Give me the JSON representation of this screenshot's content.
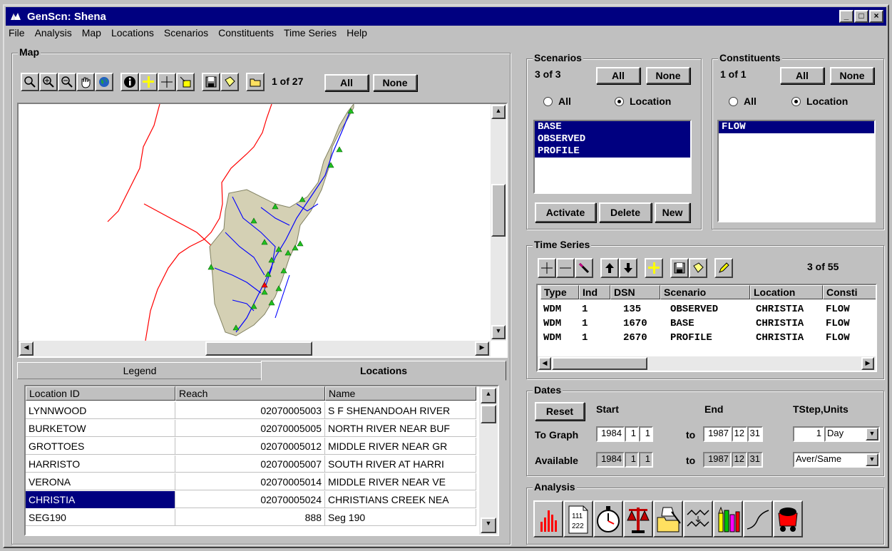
{
  "window": {
    "title": "GenScn: Shena"
  },
  "menu": [
    "File",
    "Analysis",
    "Map",
    "Locations",
    "Scenarios",
    "Constituents",
    "Time Series",
    "Help"
  ],
  "map": {
    "label": "Map",
    "count": "1 of 27",
    "all": "All",
    "none": "None",
    "tabs": {
      "legend": "Legend",
      "locations": "Locations"
    }
  },
  "locations": {
    "headers": [
      "Location ID",
      "Reach",
      "Name"
    ],
    "rows": [
      {
        "id": "LYNNWOOD",
        "reach": "02070005003",
        "name": "S F SHENANDOAH RIVER"
      },
      {
        "id": "BURKETOW",
        "reach": "02070005005",
        "name": "NORTH RIVER NEAR BUF"
      },
      {
        "id": "GROTTOES",
        "reach": "02070005012",
        "name": "MIDDLE RIVER NEAR GR"
      },
      {
        "id": "HARRISTO",
        "reach": "02070005007",
        "name": "SOUTH RIVER AT HARRI"
      },
      {
        "id": "VERONA",
        "reach": "02070005014",
        "name": "MIDDLE RIVER NEAR VE"
      },
      {
        "id": "CHRISTIA",
        "reach": "02070005024",
        "name": "CHRISTIANS CREEK NEA"
      },
      {
        "id": "SEG190",
        "reach": "888",
        "name": "Seg 190"
      }
    ],
    "selected": 5
  },
  "scenarios": {
    "label": "Scenarios",
    "count": "3 of 3",
    "all": "All",
    "none": "None",
    "radio_all": "All",
    "radio_location": "Location",
    "items": [
      "BASE",
      "OBSERVED",
      "PROFILE"
    ],
    "activate": "Activate",
    "delete": "Delete",
    "new": "New"
  },
  "constituents": {
    "label": "Constituents",
    "count": "1 of 1",
    "all": "All",
    "none": "None",
    "radio_all": "All",
    "radio_location": "Location",
    "items": [
      "FLOW"
    ]
  },
  "timeseries": {
    "label": "Time Series",
    "count": "3 of 55",
    "headers": [
      "Type",
      "Ind",
      "DSN",
      "Scenario",
      "Location",
      "Consti"
    ],
    "rows": [
      [
        "WDM",
        "1",
        "135",
        "OBSERVED",
        "CHRISTIA",
        "FLOW"
      ],
      [
        "WDM",
        "1",
        "1670",
        "BASE",
        "CHRISTIA",
        "FLOW"
      ],
      [
        "WDM",
        "1",
        "2670",
        "PROFILE",
        "CHRISTIA",
        "FLOW"
      ]
    ]
  },
  "dates": {
    "label": "Dates",
    "reset": "Reset",
    "start": "Start",
    "end": "End",
    "tstep_units": "TStep,Units",
    "to_graph": "To Graph",
    "available": "Available",
    "to": "to",
    "graph_start": [
      "1984",
      "1",
      "1"
    ],
    "graph_end": [
      "1987",
      "12",
      "31"
    ],
    "avail_start": [
      "1984",
      "1",
      "1"
    ],
    "avail_end": [
      "1987",
      "12",
      "31"
    ],
    "tstep": "1",
    "units": "Day",
    "aggregation": "Aver/Same"
  },
  "analysis": {
    "label": "Analysis",
    "list_icon_text": [
      "111",
      "222"
    ]
  },
  "colors": {
    "title_bar": "#000080",
    "boundary": "#ff0000",
    "streams": "#0000ff",
    "basin": "#d4d0b4",
    "station": "#00c000"
  }
}
